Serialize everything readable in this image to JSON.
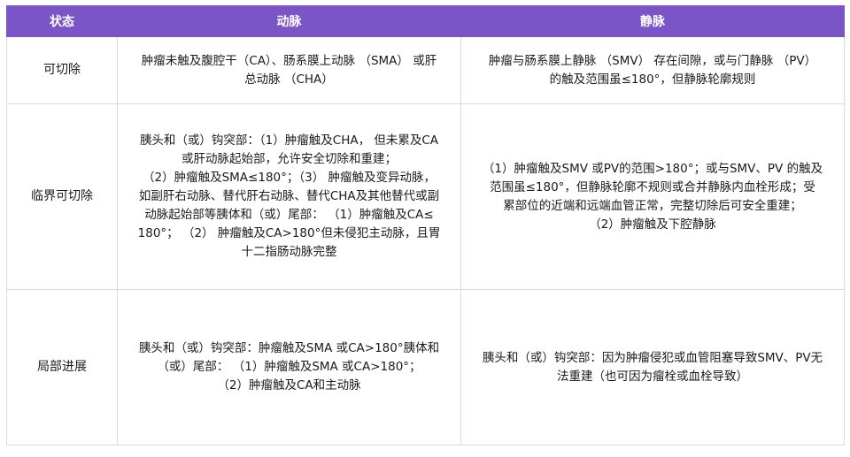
{
  "table": {
    "headers": [
      "状态",
      "动脉",
      "静脉"
    ],
    "rows": [
      {
        "state": "可切除",
        "artery": [
          "肿瘤未触及腹腔干（CA）、肠系膜上动脉 （SMA） 或肝",
          "总动脉 （CHA）"
        ],
        "vein": [
          "肿瘤与肠系膜上静脉 （SMV） 存在间隙，或与门静脉 （PV）",
          "的触及范围虽≤180°，但静脉轮廓规则"
        ]
      },
      {
        "state": "临界可切除",
        "artery": [
          "胰头和（或）钩突部：（1）肿瘤触及CHA，  但未累及CA",
          "或肝动脉起始部，允许安全切除和重建；",
          "（2）肿瘤触及SMA≤180°；（3） 肿瘤触及变异动脉，",
          "如副肝右动脉、替代肝右动脉、替代CHA及其他替代或副",
          "动脉起始部等胰体和（或）尾部： （1）肿瘤触及CA≤",
          "180°；      （2） 肿瘤触及CA>180°但未侵犯主动脉，且胃",
          "十二指肠动脉完整"
        ],
        "vein": [
          "（1）肿瘤触及SMV 或PV的范围>180°；或与SMV、PV 的触及",
          "范围虽≤180°，但静脉轮廓不规则或合并静脉内血栓形成；受",
          "累部位的近端和远端血管正常，完整切除后可安全重建；",
          "（2）肿瘤触及下腔静脉"
        ]
      },
      {
        "state": "局部进展",
        "artery": [
          "胰头和（或）钩突部：肿瘤触及SMA 或CA>180°胰体和",
          "（或）尾部： （1）肿瘤触及SMA 或CA>180°；",
          "（2）肿瘤触及CA和主动脉"
        ],
        "vein": [
          "胰头和（或）钩突部：因为肿瘤侵犯或血管阻塞导致SMV、PV无",
          "法重建（也可因为瘤栓或血栓导致）"
        ]
      }
    ]
  }
}
